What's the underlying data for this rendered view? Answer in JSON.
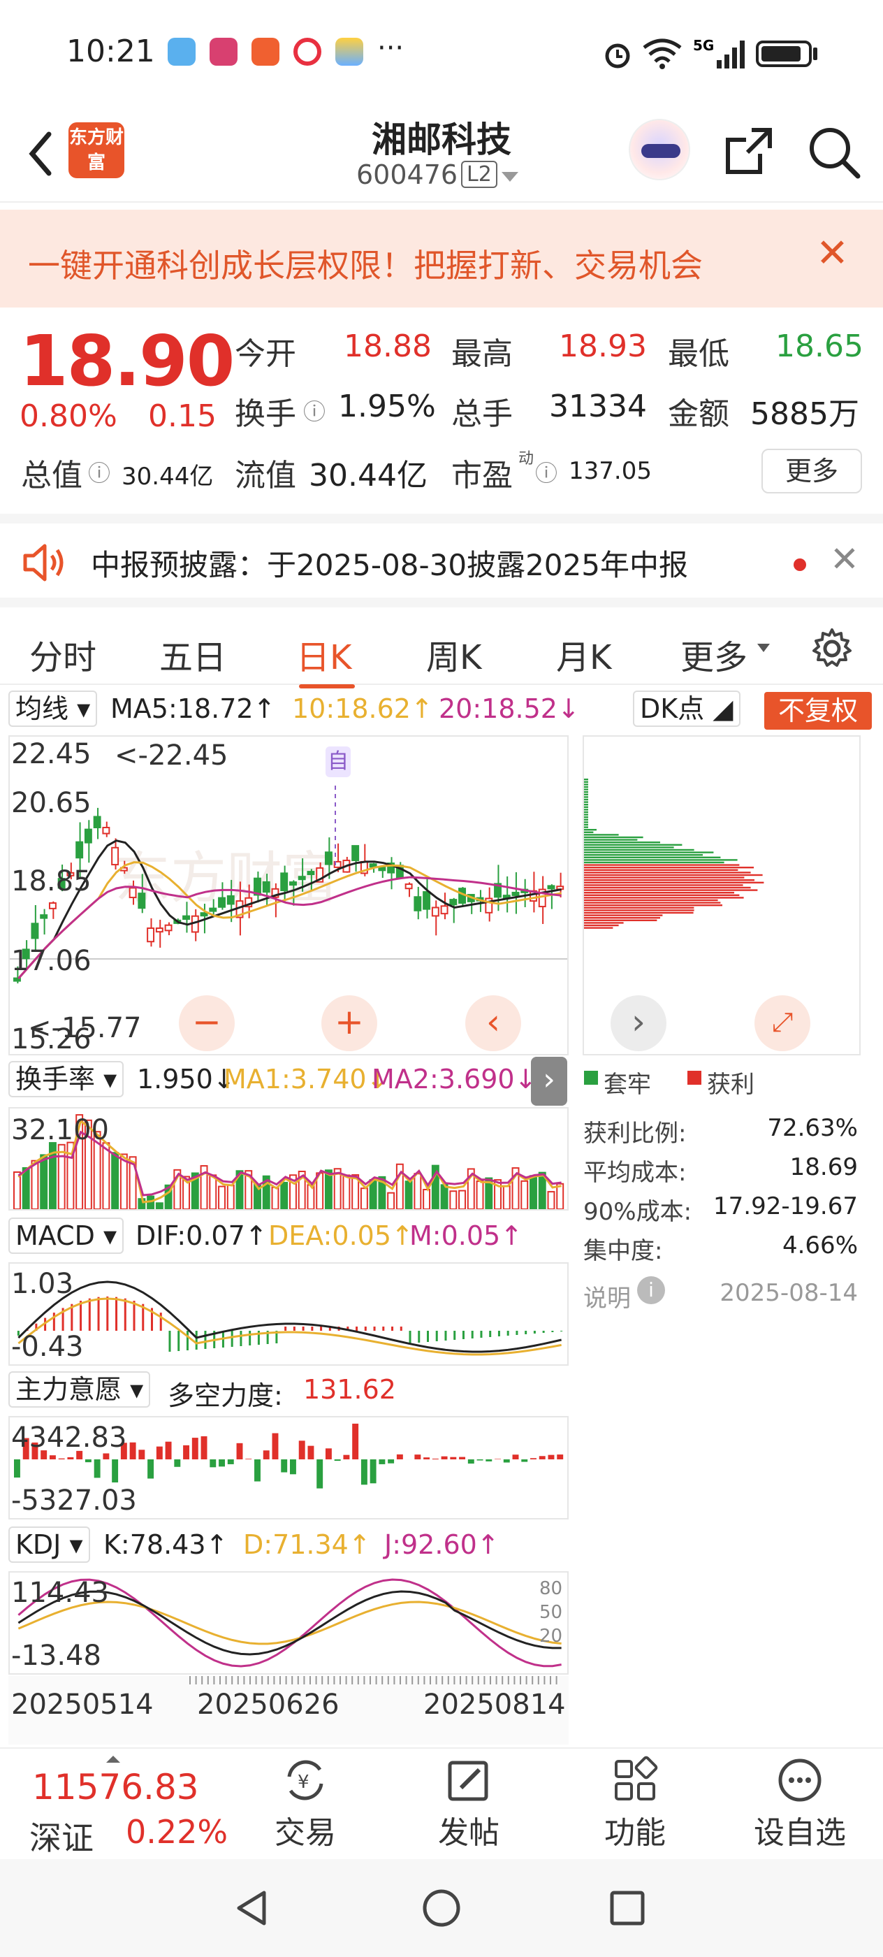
{
  "status_bar": {
    "time": "10:21",
    "more": "···"
  },
  "header": {
    "brand_logo": "东方财富",
    "stock_name": "湘邮科技",
    "stock_code": "600476",
    "level_badge": "L2"
  },
  "banner": {
    "text": "一键开通科创成长层权限！把握打新、交易机会"
  },
  "quote": {
    "price": "18.90",
    "change_pct": "0.80%",
    "change": "0.15",
    "open_label": "今开",
    "open": "18.88",
    "high_label": "最高",
    "high": "18.93",
    "low_label": "最低",
    "low": "18.65",
    "turnover_label": "换手",
    "turnover": "1.95%",
    "volume_label": "总手",
    "volume": "31334",
    "amount_label": "金额",
    "amount": "5885万",
    "total_cap_label": "总值",
    "total_cap": "30.44亿",
    "float_cap_label": "流值",
    "float_cap": "30.44亿",
    "pe_label": "市盈",
    "pe_sup": "动",
    "pe": "137.05",
    "more_button": "更多"
  },
  "notice": {
    "text": "中报预披露：于2025-08-30披露2025年中报"
  },
  "tabs": [
    "分时",
    "五日",
    "日K",
    "周K",
    "月K",
    "更多"
  ],
  "active_tab": "日K",
  "chart": {
    "ma_selector": "均线",
    "ma5": "MA5:18.72↑",
    "ma10": "10:18.62↑",
    "ma20": "20:18.52↓",
    "dk_button": "DK点",
    "adjust_button": "不复权",
    "y_labels": [
      "22.45",
      "20.65",
      "18.85",
      "17.06",
      "15.26"
    ],
    "max_note": "<-22.45",
    "min_note": "<-15.77",
    "event_marker": "自",
    "turnover_selector": "换手率",
    "turnover_value": "1.950↓",
    "turnover_ma1": "MA1:3.740↓",
    "turnover_ma2": "MA2:3.690↓",
    "turnover_max": "32.100",
    "macd_selector": "MACD",
    "dif": "DIF:0.07↑",
    "dea": "DEA:0.05↑",
    "macd_m": "M:0.05↑",
    "macd_max": "1.03",
    "macd_min": "-0.43",
    "main_selector": "主力意愿",
    "duokong": "多空力度:",
    "duokong_value": "131.62",
    "main_max": "4342.83",
    "main_min": "-5327.03",
    "kdj_selector": "KDJ",
    "k": "K:78.43↑",
    "d": "D:71.34↑",
    "j": "J:92.60↑",
    "kdj_max": "114.43",
    "kdj_min": "-13.48",
    "kdj_levels": [
      "80",
      "50",
      "20"
    ],
    "dates": [
      "20250514",
      "20250626",
      "20250814"
    ]
  },
  "chip": {
    "legend_trapped": "套牢",
    "legend_profit": "获利",
    "profit_ratio_label": "获利比例:",
    "profit_ratio": "72.63%",
    "avg_cost_label": "平均成本:",
    "avg_cost": "18.69",
    "cost90_label": "90%成本:",
    "cost90": "17.92-19.67",
    "concentration_label": "集中度:",
    "concentration": "4.66%",
    "note_label": "说明",
    "date": "2025-08-14"
  },
  "bottom_bar": {
    "index_value": "11576.83",
    "index_name": "深证",
    "index_pct": "0.22%",
    "trade": "交易",
    "post": "发帖",
    "functions": "功能",
    "watchlist": "设自选"
  },
  "colors": {
    "up": "#e0302a",
    "down": "#2aa040",
    "accent": "#e8542a"
  }
}
